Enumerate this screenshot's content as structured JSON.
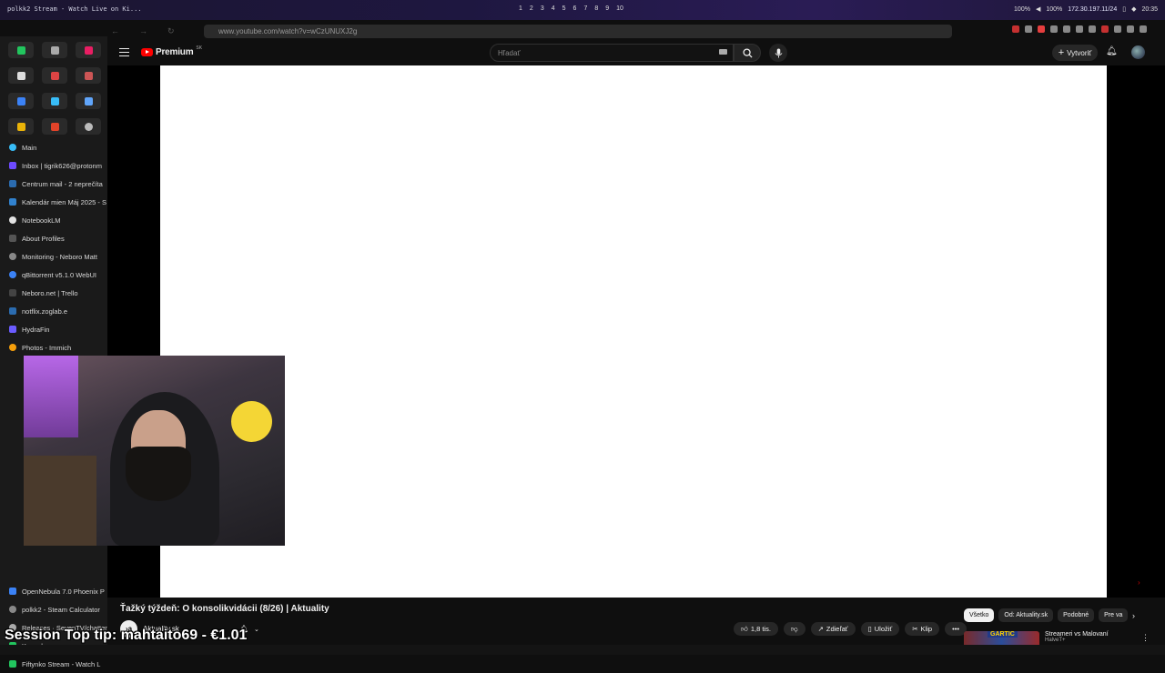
{
  "system": {
    "window_title": "polkk2 Stream - Watch Live on Ki...",
    "workspaces": [
      "1",
      "2",
      "3",
      "4",
      "5",
      "6",
      "7",
      "8",
      "9",
      "10"
    ],
    "battery": "100%",
    "volume": "100%",
    "ip": "172.30.197.11/24",
    "clock": "20:35"
  },
  "browser": {
    "url": "www.youtube.com/watch?v=wCzUNUXJ2g"
  },
  "sidebar": {
    "section": "Main",
    "tabs": [
      {
        "label": "Inbox | tigrik626@protonm",
        "color": "#6d4aff"
      },
      {
        "label": "Centrum mail - 2 neprečíta",
        "color": "#2b6cb0"
      },
      {
        "label": "Kalendár mien Máj 2025 - S",
        "color": "#3182ce"
      },
      {
        "label": "NotebookLM",
        "color": "#e2e2e2"
      },
      {
        "label": "About Profiles",
        "color": "#555"
      },
      {
        "label": "Monitoring - Neboro Matt",
        "color": "#888"
      },
      {
        "label": "qBittorrent v5.1.0 WebUI",
        "color": "#3b82f6"
      },
      {
        "label": "Neboro.net | Trello",
        "color": "#444"
      },
      {
        "label": "notflix.zoglab.e",
        "color": "#2b6cb0"
      },
      {
        "label": "HydraFin",
        "color": "#6b5cff"
      },
      {
        "label": "Photos - Immich",
        "color": "#f59e0b"
      }
    ],
    "tabs_bottom": [
      {
        "label": "OpenNebula 7.0 Phoenix P",
        "color": "#3b82f6"
      },
      {
        "label": "polkk2 - Steam Calculator",
        "color": "#888"
      },
      {
        "label": "Releases · SevenTV/chatter",
        "color": "#aaa"
      },
      {
        "label": "Konzoly",
        "color": "#22c55e"
      },
      {
        "label": "Fiftynko Stream - Watch L",
        "color": "#22c55e"
      }
    ]
  },
  "youtube": {
    "brand": "Premium",
    "region": "SK",
    "search_placeholder": "Hľadať",
    "create_label": "Vytvoriť",
    "video_title": "Ťažký týždeň: O konsolikvidácii (8/26) | Aktuality",
    "channel_name": "Aktuality.sk",
    "channel_avatar": "›a",
    "likes": "1,8 tis.",
    "share_label": "Zdieľať",
    "save_label": "Uložiť",
    "clip_label": "Klip",
    "chips": [
      "Všetko",
      "Od: Aktuality.sk",
      "Podobné",
      "Pre va"
    ],
    "rec_thumb_text": "GARTIC",
    "rec_title": "Streameri vs Malovaní",
    "rec_sub": "HalveT+"
  },
  "overlay": {
    "text": "Session Top tip: mahtaito69 - €1.01"
  },
  "colors": {
    "accent_red": "#ff0000",
    "bg": "#0f0f0f"
  }
}
